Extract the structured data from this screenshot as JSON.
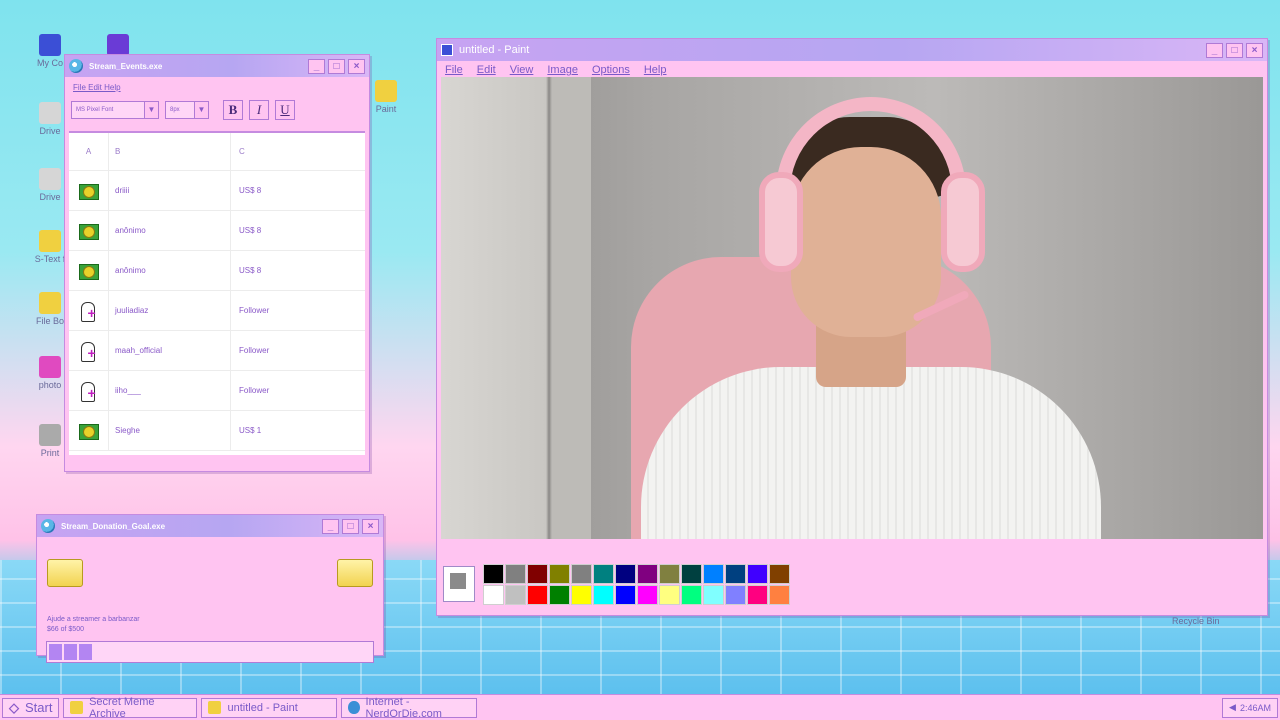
{
  "desktop": {
    "icons": [
      {
        "label": "My Co",
        "color": "#3b4fd6"
      },
      {
        "label": "",
        "color": "#6a3bd6"
      },
      {
        "label": "Drive",
        "color": "#d6d6d6"
      },
      {
        "label": "Drive",
        "color": "#d6d6d6"
      },
      {
        "label": "S-Text f",
        "color": "#f0d040"
      },
      {
        "label": "File Bo",
        "color": "#f0d040"
      },
      {
        "label": "photo",
        "color": "#e04ac0"
      },
      {
        "label": "Print",
        "color": "#aaaaaa"
      },
      {
        "label": "Paint",
        "color": "#f0d040"
      }
    ],
    "recycle_bin": "Recycle Bin"
  },
  "events_window": {
    "title": "Stream_Events.exe",
    "menu": "File Edit Help",
    "font_select": "MS Pixel Font",
    "size_select": "8px",
    "bold": "B",
    "italic": "I",
    "underline": "U",
    "columns": [
      "A",
      "B",
      "C"
    ],
    "rows": [
      {
        "type": "money",
        "name": "driiii",
        "value": "US$ 8"
      },
      {
        "type": "money",
        "name": "anônimo",
        "value": "US$ 8"
      },
      {
        "type": "money",
        "name": "anônimo",
        "value": "US$ 8"
      },
      {
        "type": "follow",
        "name": "juuliadiaz",
        "value": "Follower"
      },
      {
        "type": "follow",
        "name": "maah_official",
        "value": "Follower"
      },
      {
        "type": "follow",
        "name": "iiho___",
        "value": "Follower"
      },
      {
        "type": "money",
        "name": "Sieghe",
        "value": "US$ 1"
      }
    ]
  },
  "goal_window": {
    "title": "Stream_Donation_Goal.exe",
    "description": "Ajude a streamer a barbanzar",
    "progress_text": "$66 of $500",
    "progress": 0.132
  },
  "paint_window": {
    "title": "untitled - Paint",
    "menu": [
      "File",
      "Edit",
      "View",
      "Image",
      "Options",
      "Help"
    ],
    "palette": [
      "#000000",
      "#808080",
      "#800000",
      "#808000",
      "#808080",
      "#008080",
      "#000080",
      "#800080",
      "#808040",
      "#004040",
      "#0080ff",
      "#004080",
      "#4000ff",
      "#804000",
      "#ffffff",
      "#c0c0c0",
      "#ff0000",
      "#008000",
      "#ffff00",
      "#00ffff",
      "#0000ff",
      "#ff00ff",
      "#ffff80",
      "#00ff80",
      "#80ffff",
      "#8080ff",
      "#ff0080",
      "#ff8040"
    ]
  },
  "taskbar": {
    "start": "Start",
    "items": [
      "Secret Meme Archive",
      "untitled - Paint",
      "Internet - NerdOrDie.com"
    ],
    "clock": "2:46AM"
  }
}
